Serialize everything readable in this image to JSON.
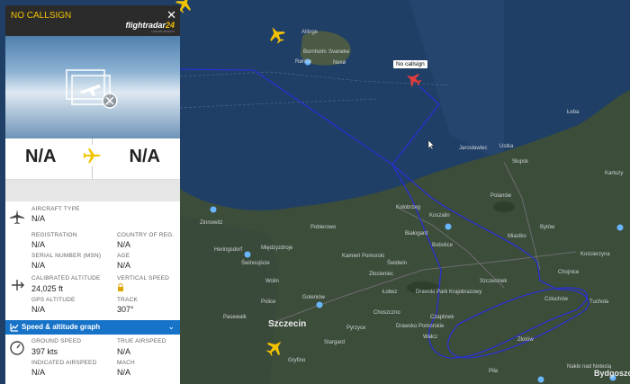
{
  "panel": {
    "callsign": "NO CALLSIGN",
    "close": "✕",
    "logo_main": "flightradar",
    "logo_num": "24",
    "logo_sub": "LIVE AIR TRAFFIC",
    "route_from": "N/A",
    "route_to": "N/A",
    "aircraft_type_label": "AIRCRAFT TYPE",
    "aircraft_type": "N/A",
    "registration_label": "REGISTRATION",
    "registration": "N/A",
    "country_label": "COUNTRY OF REG.",
    "country": "N/A",
    "serial_label": "SERIAL NUMBER (MSN)",
    "serial": "N/A",
    "age_label": "AGE",
    "age": "N/A",
    "cal_alt_label": "CALIBRATED ALTITUDE",
    "cal_alt": "24,025 ft",
    "vs_label": "VERTICAL SPEED",
    "gps_alt_label": "GPS ALTITUDE",
    "gps_alt": "N/A",
    "track_label": "TRACK",
    "track": "307°",
    "graph_label": "Speed & altitude graph",
    "gs_label": "GROUND SPEED",
    "gs": "397 kts",
    "tas_label": "TRUE AIRSPEED",
    "tas": "N/A",
    "ias_label": "INDICATED AIRSPEED",
    "ias": "N/A",
    "mach_label": "MACH",
    "mach": "N/A"
  },
  "map": {
    "flight_tag": "No callsign",
    "places": [
      "Allinge",
      "Rønne",
      "Bornholm",
      "Svaneke",
      "Nexø",
      "Łeba",
      "Słupsk",
      "Jarosławiec",
      "Ustka",
      "Kołobrzeg",
      "Koszalin",
      "Miastko",
      "Bytów",
      "Kościerzyna",
      "Bobolice",
      "Polanów",
      "Białogard",
      "Świdwin",
      "Drawski Park Krajobrazowy",
      "Szczecinek",
      "Człuchów",
      "Tuchola",
      "Wałcz",
      "Piła",
      "Złotów",
      "Chojnice",
      "Bydgoszcz",
      "Szczecin",
      "Stargard",
      "Goleniów",
      "Police",
      "Świnoujście",
      "Heringsdorf",
      "Międzyzdroje",
      "Pasewalk",
      "Zinnowitz",
      "Gryfino",
      "Pyrzyce",
      "Choszczno",
      "Łobez",
      "Pobierowo",
      "Kartuzy",
      "Nakło nad Notecią",
      "Wolin",
      "Kamień Pomorski",
      "Czaplinek",
      "Złocieniec",
      "Drawsko Pomorskie"
    ]
  }
}
